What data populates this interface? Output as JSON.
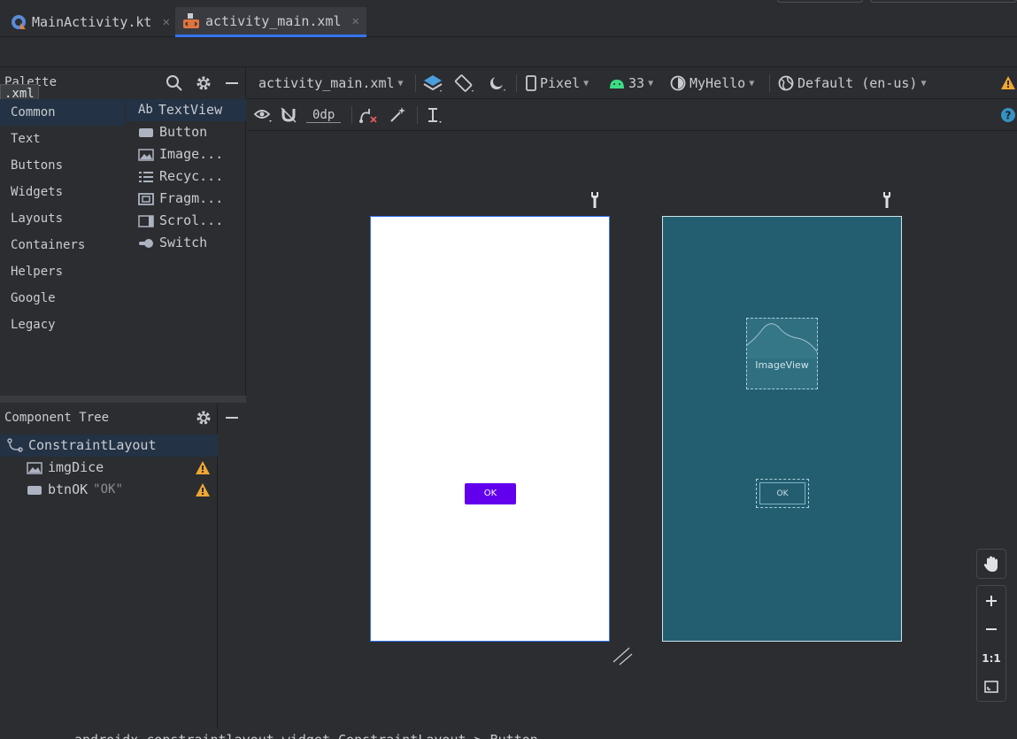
{
  "tabs": [
    {
      "label": "MainActivity.kt",
      "active": false
    },
    {
      "label": "activity_main.xml",
      "active": true
    }
  ],
  "palette": {
    "title": "Palette",
    "tooltip": ".xml",
    "categories": [
      "Common",
      "Text",
      "Buttons",
      "Widgets",
      "Layouts",
      "Containers",
      "Helpers",
      "Google",
      "Legacy"
    ],
    "selected_category": "Common",
    "widgets": [
      {
        "icon": "ab-text-icon",
        "label": "TextView",
        "prefix": "Ab"
      },
      {
        "icon": "button-icon",
        "label": "Button"
      },
      {
        "icon": "image-icon",
        "label": "Image..."
      },
      {
        "icon": "list-icon",
        "label": "Recyc..."
      },
      {
        "icon": "fragment-icon",
        "label": "Fragm..."
      },
      {
        "icon": "scroll-icon",
        "label": "Scrol..."
      },
      {
        "icon": "switch-icon",
        "label": "Switch"
      }
    ]
  },
  "component_tree": {
    "title": "Component Tree",
    "root": "ConstraintLayout",
    "children": [
      {
        "name": "imgDice",
        "value": "",
        "warning": true
      },
      {
        "name": "btnOK",
        "value": "\"OK\"",
        "warning": true
      }
    ]
  },
  "toolbar": {
    "file": "activity_main.xml",
    "device": "Pixel",
    "api": "33",
    "theme": "MyHello",
    "locale": "Default (en-us)",
    "margin": "0dp"
  },
  "design": {
    "button_label": "OK",
    "blueprint_image_label": "ImageView",
    "blueprint_button_label": "OK"
  },
  "zoom": {
    "actual_size": "1:1"
  },
  "status": {
    "breadcrumb": "androidx.constraintlayout.widget.ConstraintLayout > Button"
  },
  "colors": {
    "accent": "#3574f0",
    "button": "#6200ee",
    "blueprint": "#235e70",
    "warning": "#f0a732"
  }
}
